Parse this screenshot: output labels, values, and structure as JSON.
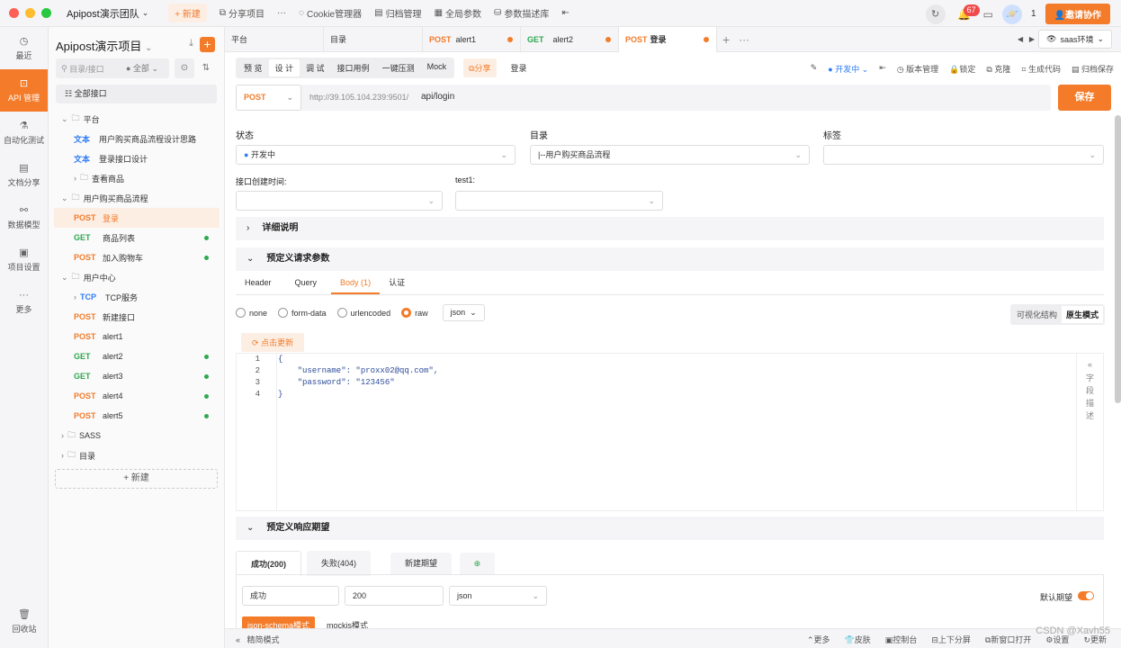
{
  "top": {
    "team": "Apipost演示团队",
    "new": "+ 新建",
    "share": "分享项目",
    "more": "···",
    "cookie": "Cookie管理器",
    "archive": "归档管理",
    "global": "全局参数",
    "paramdb": "参数描述库",
    "badge": "67",
    "user_count": "1",
    "invite": "邀请协作"
  },
  "nav": [
    {
      "label": "最近",
      "icon": "clock"
    },
    {
      "label": "API 管理",
      "icon": "api"
    },
    {
      "label": "自动化测试",
      "icon": "test"
    },
    {
      "label": "文档分享",
      "icon": "doc"
    },
    {
      "label": "数据模型",
      "icon": "model"
    },
    {
      "label": "项目设置",
      "icon": "settings"
    },
    {
      "label": "更多",
      "icon": "more"
    }
  ],
  "nav_bottom": "回收站",
  "side": {
    "project": "Apipost演示项目",
    "search_ph": "目录/接口",
    "filter": "● 全部",
    "all": "全部接口",
    "new_btn": "+ 新建"
  },
  "tree": [
    {
      "t": "folder",
      "label": "平台",
      "lvl": 0
    },
    {
      "t": "doc",
      "m": "文本",
      "label": "用户购买商品流程设计思路",
      "lvl": 1
    },
    {
      "t": "doc",
      "m": "文本",
      "label": "登录接口设计",
      "lvl": 1
    },
    {
      "t": "folder",
      "label": "查看商品",
      "lvl": 1
    },
    {
      "t": "folder",
      "label": "用户购买商品流程",
      "lvl": 0
    },
    {
      "t": "post",
      "m": "POST",
      "label": "登录",
      "lvl": 1,
      "act": true
    },
    {
      "t": "get",
      "m": "GET",
      "label": "商品列表",
      "lvl": 1,
      "dot": true
    },
    {
      "t": "post",
      "m": "POST",
      "label": "加入购物车",
      "lvl": 1,
      "dot": true
    },
    {
      "t": "folder",
      "label": "用户中心",
      "lvl": 0
    },
    {
      "t": "tcp",
      "m": "TCP",
      "label": "TCP服务",
      "lvl": 1
    },
    {
      "t": "post",
      "m": "POST",
      "label": "新建接口",
      "lvl": 1
    },
    {
      "t": "post",
      "m": "POST",
      "label": "alert1",
      "lvl": 1
    },
    {
      "t": "get",
      "m": "GET",
      "label": "alert2",
      "lvl": 1,
      "dot": true
    },
    {
      "t": "get",
      "m": "GET",
      "label": "alert3",
      "lvl": 1,
      "dot": true
    },
    {
      "t": "post",
      "m": "POST",
      "label": "alert4",
      "lvl": 1,
      "dot": true
    },
    {
      "t": "post",
      "m": "POST",
      "label": "alert5",
      "lvl": 1,
      "dot": true
    },
    {
      "t": "folder",
      "label": "SASS",
      "lvl": 0
    },
    {
      "t": "folder",
      "label": "目录",
      "lvl": 0
    }
  ],
  "tabs": [
    {
      "label": "平台"
    },
    {
      "label": "目录"
    },
    {
      "m": "POST",
      "label": "alert1",
      "dot": true
    },
    {
      "m": "GET",
      "label": "alert2",
      "dot": true
    },
    {
      "m": "POST",
      "label": "登录",
      "dot": true,
      "act": true
    }
  ],
  "env": "saas环境",
  "sub": {
    "modes": [
      "预 览",
      "设 计",
      "调 试",
      "接口用例",
      "一键压测",
      "Mock"
    ],
    "active": 1,
    "share": "分享",
    "name": "登录",
    "status": "● 开发中",
    "tools": [
      "版本管理",
      "锁定",
      "克隆",
      "生成代码",
      "归档保存"
    ]
  },
  "url": {
    "method": "POST",
    "host": "http://39.105.104.239:9501/",
    "path": "api/login",
    "save": "保存"
  },
  "form": {
    "status_l": "状态",
    "status_v": "开发中",
    "dir_l": "目录",
    "dir_v": "|--用户购买商品流程",
    "tag_l": "标签",
    "created_l": "接口创建时间:",
    "test_l": "test1:"
  },
  "sections": {
    "detail": "详细说明",
    "req": "预定义请求参数",
    "resp": "预定义响应期望"
  },
  "btabs": [
    "Header",
    "Query",
    "Body (1)",
    "认证"
  ],
  "body": {
    "modes": [
      "none",
      "form-data",
      "urlencoded",
      "raw"
    ],
    "fmt": "json",
    "vis": "可视化结构",
    "raw": "原生模式",
    "update": "点击更新",
    "field_desc": "字段描述"
  },
  "code": [
    "{",
    "    \"username\": \"proxx02@qq.com\",",
    "    \"password\": \"123456\"",
    "}"
  ],
  "resp": {
    "tabs": [
      "成功(200)",
      "失败(404)",
      "新建期望"
    ],
    "name": "成功",
    "code": "200",
    "fmt": "json",
    "default": "默认期望",
    "schema": "json-schema模式",
    "mock": "mockjs模式"
  },
  "foot": {
    "simple": "精简模式",
    "items": [
      "更多",
      "皮肤",
      "控制台",
      "上下分屏",
      "新窗口打开",
      "设置",
      "更新"
    ],
    "wm": "CSDN @Xavh55"
  },
  "colors": {
    "accent": "#f37b29",
    "get": "#2fa84f"
  }
}
